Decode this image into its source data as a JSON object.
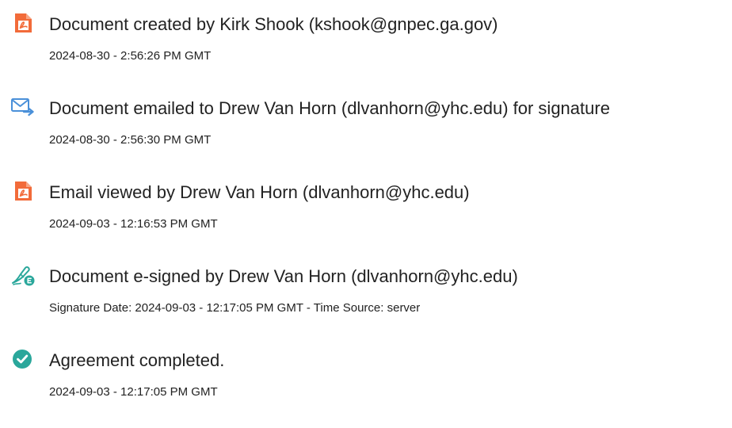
{
  "audit_history": {
    "events": [
      {
        "icon": "document-created-icon",
        "title": "Document created by Kirk Shook (kshook@gnpec.ga.gov)",
        "time": "2024-08-30 - 2:56:26 PM GMT"
      },
      {
        "icon": "email-sent-icon",
        "title": "Document emailed to Drew Van Horn (dlvanhorn@yhc.edu) for signature",
        "time": "2024-08-30 - 2:56:30 PM GMT"
      },
      {
        "icon": "email-viewed-icon",
        "title": "Email viewed by Drew Van Horn (dlvanhorn@yhc.edu)",
        "time": "2024-09-03 - 12:16:53 PM GMT"
      },
      {
        "icon": "e-signed-icon",
        "title": "Document e-signed by Drew Van Horn (dlvanhorn@yhc.edu)",
        "time": "Signature Date: 2024-09-03 - 12:17:05 PM GMT - Time Source: server"
      },
      {
        "icon": "agreement-completed-icon",
        "title": "Agreement completed.",
        "time": "2024-09-03 - 12:17:05 PM GMT"
      }
    ]
  },
  "colors": {
    "document_icon": "#f26b3a",
    "email_icon": "#4a90d9",
    "signature_icon": "#2aa79b",
    "completed_icon": "#2aa79b",
    "text": "#222222"
  }
}
